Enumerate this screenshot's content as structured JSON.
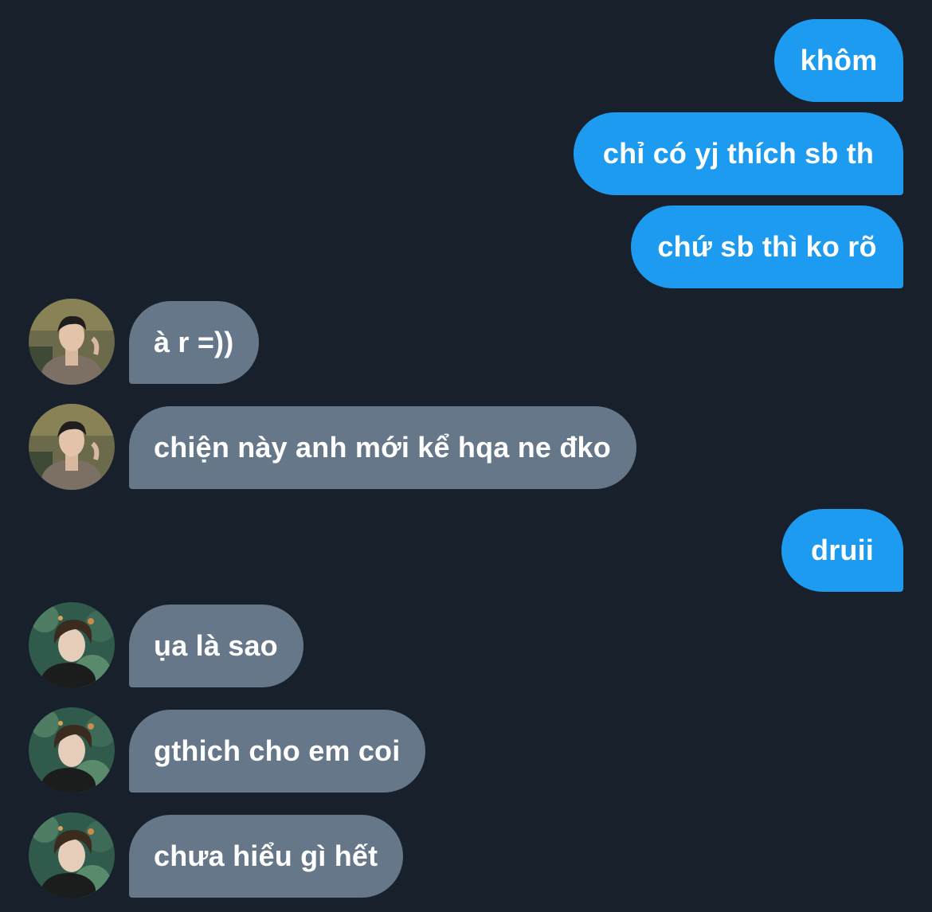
{
  "messages": [
    {
      "side": "sent",
      "text": "khôm"
    },
    {
      "side": "sent",
      "text": "chỉ có yj thích sb th"
    },
    {
      "side": "sent",
      "text": "chứ sb thì ko rõ"
    },
    {
      "side": "received",
      "text": "à r =))",
      "avatar_icon": "profile-photo-icon"
    },
    {
      "side": "received",
      "text": "chiện này anh mới kể hqa ne đko",
      "avatar_icon": "profile-photo-icon"
    },
    {
      "side": "sent",
      "text": "druii"
    },
    {
      "side": "received",
      "text": "ụa là sao",
      "avatar_icon": "profile-photo-icon"
    },
    {
      "side": "received",
      "text": "gthich cho em coi",
      "avatar_icon": "profile-photo-icon"
    },
    {
      "side": "received",
      "text": "chưa hiểu gì hết",
      "avatar_icon": "profile-photo-icon"
    }
  ],
  "colors": {
    "background": "#18202b",
    "sent_bubble": "#1d9bf0",
    "received_bubble": "#66778a",
    "text": "#ffffff"
  }
}
